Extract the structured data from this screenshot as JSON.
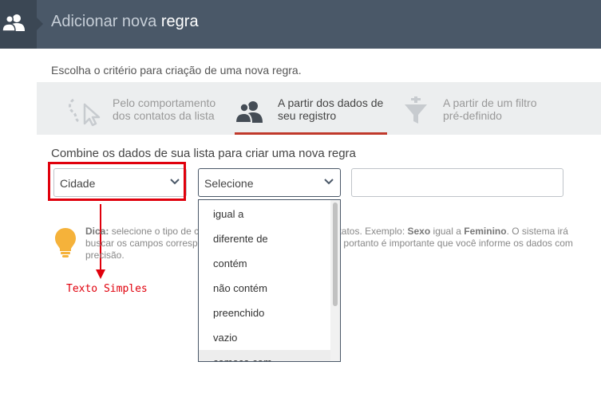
{
  "header": {
    "title_light": "Adicionar nova",
    "title_bold": "regra"
  },
  "subtitle": "Escolha o critério para criação de uma nova regra.",
  "tabs": [
    {
      "label": "Pelo comportamento\ndos contatos da lista",
      "icon": "cursor-path-icon",
      "active": false
    },
    {
      "label": "A partir dos dados de\nseu registro",
      "icon": "users-icon",
      "active": true
    },
    {
      "label": "A partir de um filtro\npré-definido",
      "icon": "funnel-icon",
      "active": false
    }
  ],
  "combine_label": "Combine os dados de sua lista para criar uma nova regra",
  "field_select": {
    "value": "Cidade"
  },
  "operator_select": {
    "value": "Selecione",
    "options": [
      "igual a",
      "diferente de",
      "contém",
      "não contém",
      "preenchido",
      "vazio",
      "começa com"
    ]
  },
  "annotation": "Texto Simples",
  "tip": {
    "label": "Dica:",
    "line1_a": "selecione o tipo de c",
    "line1_b": "contatos. Exemplo:",
    "example_field": "Sexo",
    "example_op": "igual a",
    "example_value": "Feminino",
    "line1_c": ". O sistema irá",
    "line2_a": "buscar os campos corresp",
    "line2_b": "s, portanto é importante que você informe os dados com",
    "line3": "precisão."
  },
  "colors": {
    "header": "#4a5868",
    "accent": "#c0392b",
    "annotation": "#e0000c",
    "bulb": "#f5b23a"
  }
}
